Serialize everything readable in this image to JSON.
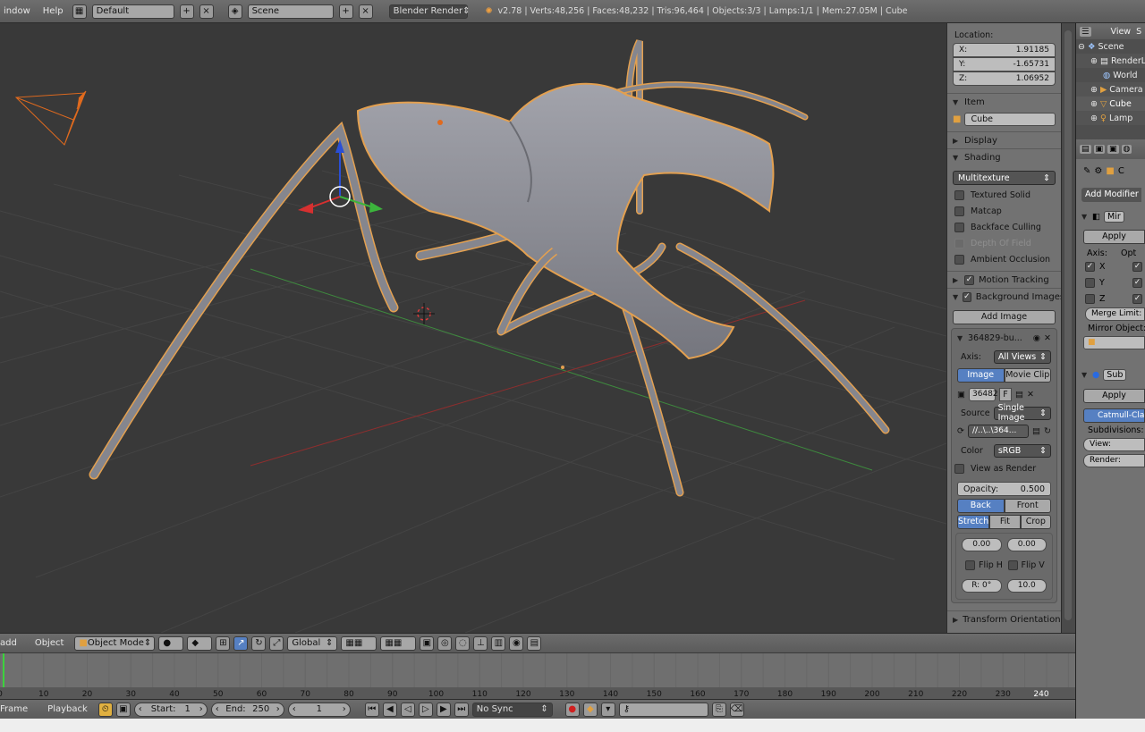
{
  "topbar": {
    "menu_window": "indow",
    "menu_help": "Help",
    "layout": "Default",
    "scene": "Scene",
    "engine": "Blender Render",
    "stats": "v2.78 | Verts:48,256 | Faces:48,232 | Tris:96,464 | Objects:3/3 | Lamps:1/1 | Mem:27.05M | Cube"
  },
  "npanel": {
    "location_label": "Location:",
    "loc_x_label": "X:",
    "loc_x": "1.91185",
    "loc_y_label": "Y:",
    "loc_y": "-1.65731",
    "loc_z_label": "Z:",
    "loc_z": "1.06952",
    "item_label": "Item",
    "item_name": "Cube",
    "display_label": "Display",
    "shading_label": "Shading",
    "shading_mode": "Multitexture",
    "textured_solid": "Textured Solid",
    "matcap": "Matcap",
    "backface_culling": "Backface Culling",
    "depth_of_field": "Depth Of Field",
    "ambient_occlusion": "Ambient Occlusion",
    "motion_tracking": "Motion Tracking",
    "background_images": "Background Images",
    "add_image": "Add Image",
    "bg_image_name": "364829-bu...",
    "axis_label": "Axis:",
    "axis_value": "All Views",
    "tab_image": "Image",
    "tab_movie_clip": "Movie Clip",
    "image_field": "36482",
    "image_flag": "F",
    "source_label": "Source",
    "source_value": "Single Image",
    "filepath": "//..\\..\\364...",
    "color_label": "Color",
    "color_value": "sRGB",
    "view_as_render": "View as Render",
    "opacity_label": "Opacity:",
    "opacity_value": "0.500",
    "back": "Back",
    "front": "Front",
    "stretch": "Stretch",
    "fit": "Fit",
    "crop": "Crop",
    "offset_x": "0.00",
    "offset_y": "0.00",
    "flip_h": "Flip H",
    "flip_v": "Flip V",
    "rotation": "R: 0°",
    "size": "10.0",
    "transform_orientations": "Transform Orientations"
  },
  "outliner": {
    "view": "View",
    "s": "S",
    "items": [
      "Scene",
      "RenderL",
      "World",
      "Camera",
      "Cube",
      "Lamp"
    ]
  },
  "props": {
    "add_modifier": "Add Modifier",
    "mirror_short": "Mir",
    "apply": "Apply",
    "axis_label": "Axis:",
    "opt_label": "Opt",
    "axis_x": "X",
    "axis_y": "Y",
    "axis_z": "Z",
    "merge_limit": "Merge Limit:",
    "mirror_object": "Mirror Object:",
    "subsurf_short": "Sub",
    "apply2": "Apply",
    "catmull": "Catmull-Clark",
    "subdivisions": "Subdivisions:",
    "view": "View:",
    "render": "Render:",
    "cube_short": "C"
  },
  "vheader": {
    "add": "add",
    "object": "Object",
    "mode": "Object Mode",
    "orientation": "Global"
  },
  "timeline": {
    "ticks": [
      "0",
      "10",
      "20",
      "30",
      "40",
      "50",
      "60",
      "70",
      "80",
      "90",
      "100",
      "110",
      "120",
      "130",
      "140",
      "150",
      "160",
      "170",
      "180",
      "190",
      "200",
      "210",
      "220",
      "230",
      "240"
    ]
  },
  "tlheader": {
    "frame": "Frame",
    "playback": "Playback",
    "start_label": "Start:",
    "start": "1",
    "end_label": "End:",
    "end": "250",
    "current": "1",
    "sync": "No Sync"
  },
  "colors": {
    "accent": "#5680c2",
    "selection_outline": "#e39c44",
    "x_axis": "#a03030",
    "y_axis": "#3c8c3c"
  }
}
